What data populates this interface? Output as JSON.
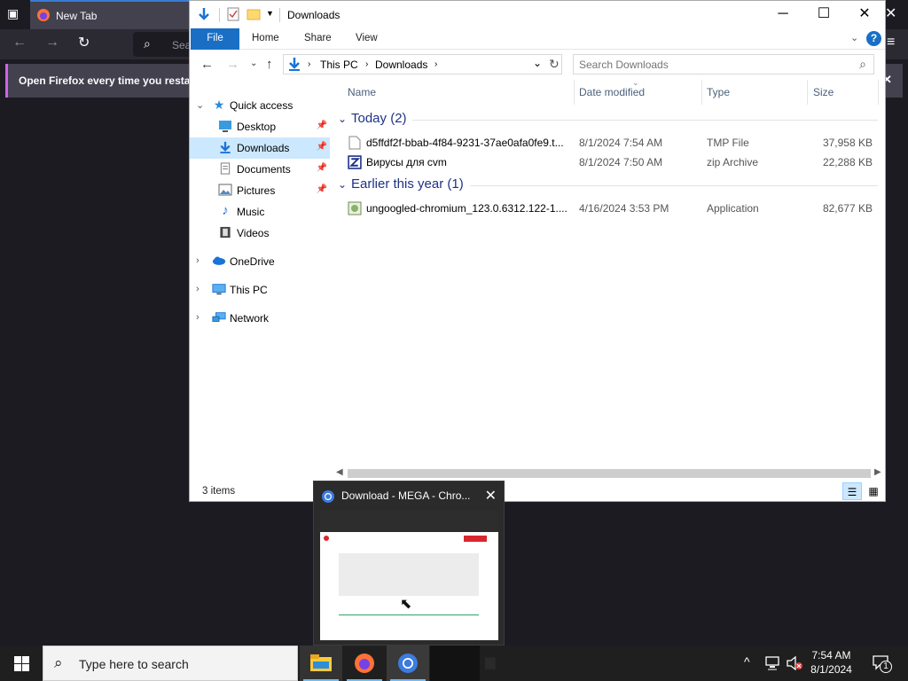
{
  "firefox": {
    "tab_title": "New Tab",
    "toolbar_search_prefix": "Sea",
    "notice_text": "Open Firefox every time you resta"
  },
  "explorer": {
    "window_title": "Downloads",
    "ribbon_tabs": [
      "File",
      "Home",
      "Share",
      "View"
    ],
    "help_label": "?",
    "breadcrumb": [
      "This PC",
      "Downloads"
    ],
    "search_placeholder": "Search Downloads",
    "nav_pane": {
      "quick_access": "Quick access",
      "items": [
        {
          "label": "Desktop",
          "icon": "desktop-icon",
          "pinned": true
        },
        {
          "label": "Downloads",
          "icon": "downloads-icon",
          "pinned": true,
          "selected": true
        },
        {
          "label": "Documents",
          "icon": "documents-icon",
          "pinned": true
        },
        {
          "label": "Pictures",
          "icon": "pictures-icon",
          "pinned": true
        },
        {
          "label": "Music",
          "icon": "music-icon",
          "pinned": false
        },
        {
          "label": "Videos",
          "icon": "videos-icon",
          "pinned": false
        }
      ],
      "onedrive": "OneDrive",
      "this_pc": "This PC",
      "network": "Network"
    },
    "columns": [
      "Name",
      "Date modified",
      "Type",
      "Size"
    ],
    "groups": [
      {
        "label": "Today (2)",
        "files": [
          {
            "name": "d5ffdf2f-bbab-4f84-9231-37ae0afa0fe9.t...",
            "date": "8/1/2024 7:54 AM",
            "type": "TMP File",
            "size": "37,958 KB",
            "icon": "tmp-file-icon"
          },
          {
            "name": "Вирусы для cvm",
            "date": "8/1/2024 7:50 AM",
            "type": "zip Archive",
            "size": "22,288 KB",
            "icon": "zip-archive-icon"
          }
        ]
      },
      {
        "label": "Earlier this year (1)",
        "files": [
          {
            "name": "ungoogled-chromium_123.0.6312.122-1....",
            "date": "4/16/2024 3:53 PM",
            "type": "Application",
            "size": "82,677 KB",
            "icon": "application-icon"
          }
        ]
      }
    ],
    "status": "3 items"
  },
  "thumbnail": {
    "title": "Download - MEGA - Chro..."
  },
  "taskbar": {
    "search_placeholder": "Type here to search",
    "time": "7:54 AM",
    "date": "8/1/2024",
    "notification_count": "1"
  }
}
